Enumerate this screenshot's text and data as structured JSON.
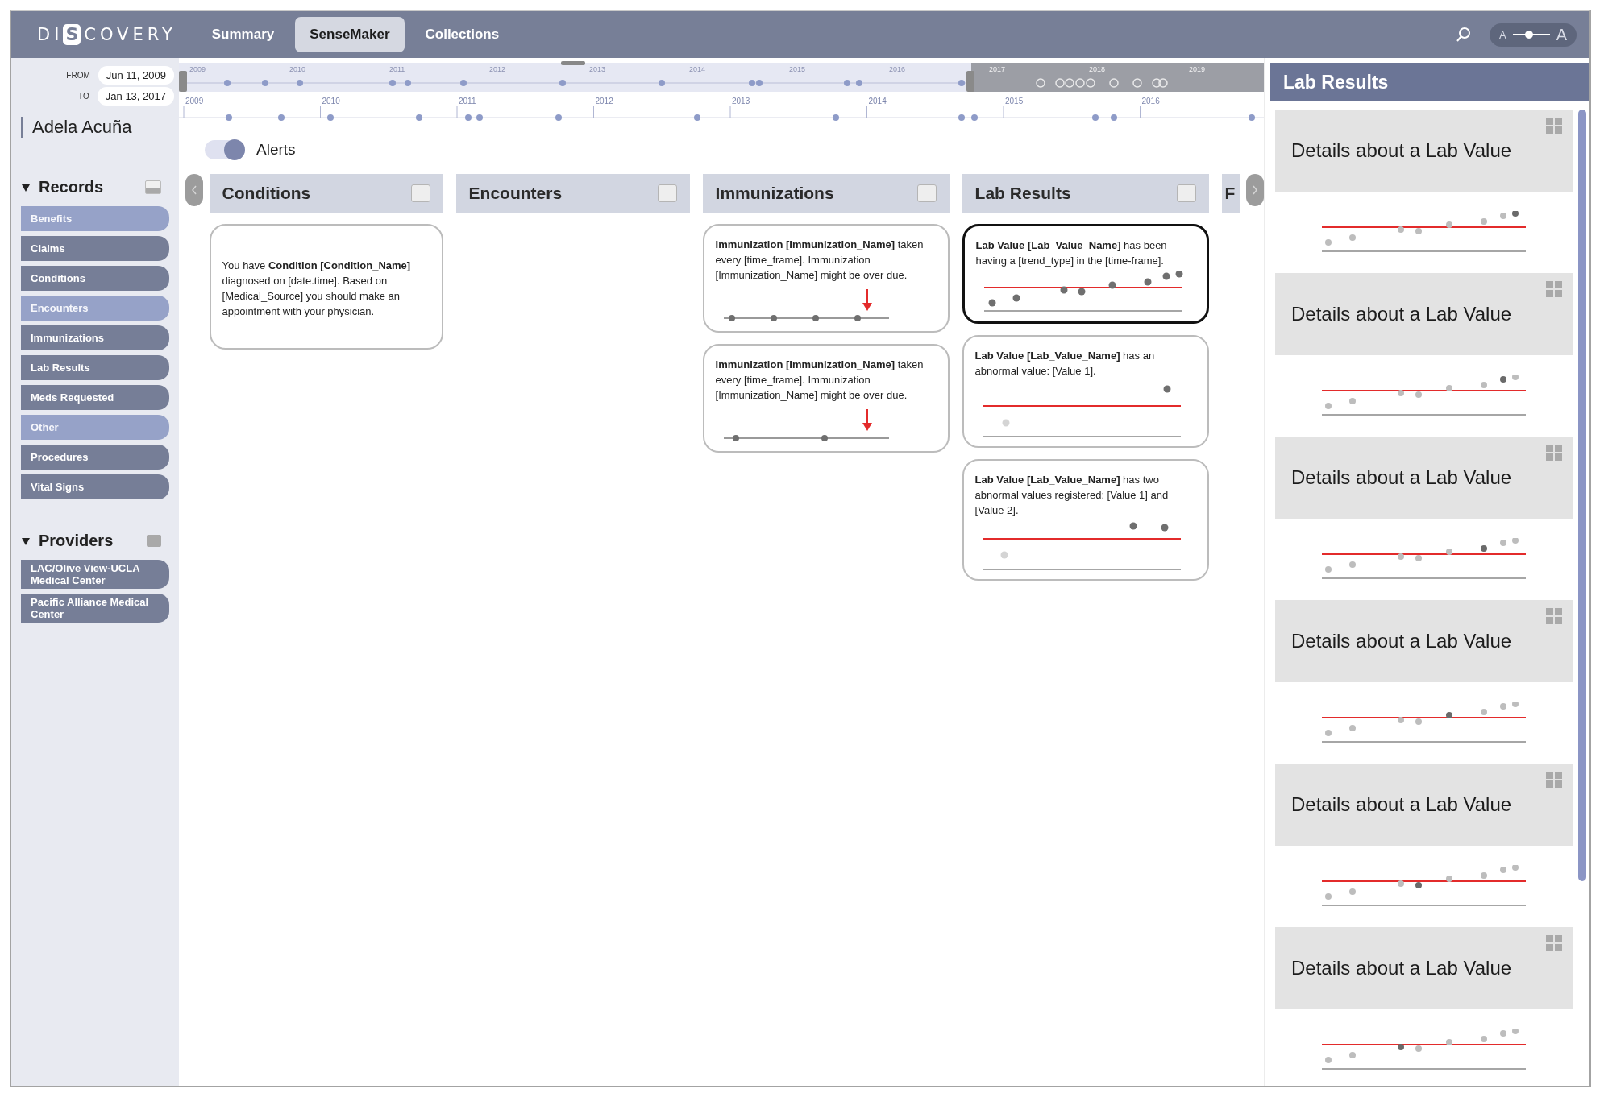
{
  "topbar": {
    "logo": {
      "before": "DI",
      "mark": "S",
      "after": "COVERY"
    },
    "nav": [
      {
        "label": "Summary",
        "selected": false
      },
      {
        "label": "SenseMaker",
        "selected": true
      },
      {
        "label": "Collections",
        "selected": false
      }
    ],
    "font_size_control": {
      "small": "A",
      "large": "A",
      "level": 0.45
    }
  },
  "date_range": {
    "from_label": "FROM",
    "from": "Jun 11, 2009",
    "to_label": "TO",
    "to": "Jan 13, 2017"
  },
  "timeline": {
    "overview_years": [
      "2009",
      "2010",
      "2011",
      "2012",
      "2013",
      "2014",
      "2015",
      "2016",
      "2017",
      "2018",
      "2019"
    ],
    "detail_years": [
      "2009",
      "2010",
      "2011",
      "2012",
      "2013",
      "2014",
      "2015",
      "2016"
    ]
  },
  "patient": {
    "name": "Adela Acuña"
  },
  "alerts_toggle": {
    "label": "Alerts",
    "on": true
  },
  "sidebar": {
    "sections": [
      {
        "title": "Records",
        "expanded": true,
        "items": [
          {
            "label": "Benefits",
            "disabled": true
          },
          {
            "label": "Claims",
            "disabled": false
          },
          {
            "label": "Conditions",
            "disabled": false
          },
          {
            "label": "Encounters",
            "disabled": true
          },
          {
            "label": "Immunizations",
            "disabled": false
          },
          {
            "label": "Lab Results",
            "disabled": false
          },
          {
            "label": "Meds Requested",
            "disabled": false
          },
          {
            "label": "Other",
            "disabled": true
          },
          {
            "label": "Procedures",
            "disabled": false
          },
          {
            "label": "Vital Signs",
            "disabled": false
          }
        ]
      },
      {
        "title": "Providers",
        "expanded": true,
        "items": [
          {
            "label": "LAC/Olive View-UCLA Medical Center",
            "disabled": false
          },
          {
            "label": "Pacific Alliance Medical Center",
            "disabled": false
          }
        ]
      }
    ]
  },
  "columns": [
    {
      "title": "Conditions",
      "checked": false,
      "cards": [
        {
          "kind": "text",
          "selected": false,
          "text": "You have **Condition [Condition_Name]** diagnosed on [date.time]. Based on [Medical_Source] you should make an appointment with your physician."
        }
      ]
    },
    {
      "title": "Encounters",
      "checked": false
    },
    {
      "title": "Immunizations",
      "checked": false,
      "cards": [
        {
          "kind": "doses-4",
          "selected": false,
          "text": "**Immunization [Immunization_Name]** taken every [time_frame]. Immunization [Immunization_Name] might be over due."
        },
        {
          "kind": "doses-2",
          "selected": false,
          "text": "**Immunization [Immunization_Name]** taken every [time_frame]. Immunization [Immunization_Name] might be over due."
        }
      ]
    },
    {
      "title": "Lab Results",
      "checked": false,
      "cards": [
        {
          "kind": "trend",
          "selected": true,
          "text": "**Lab Value [Lab_Value_Name]** has been having a [trend_type] in the [time-frame]."
        },
        {
          "kind": "abnormal-1",
          "selected": false,
          "text": "**Lab Value [Lab_Value_Name]** has an abnormal value: [Value 1]."
        },
        {
          "kind": "abnormal-2",
          "selected": false,
          "text": "**Lab Value [Lab_Value_Name]** has two abnormal values registered: [Value 1] and [Value 2]."
        }
      ]
    },
    {
      "title": "F"
    }
  ],
  "details_panel": {
    "title": "Lab Results",
    "items": [
      {
        "title": "Details about a Lab Value"
      },
      {
        "title": "Details about a Lab Value"
      },
      {
        "title": "Details about a Lab Value"
      },
      {
        "title": "Details about a Lab Value"
      },
      {
        "title": "Details about a Lab Value"
      },
      {
        "title": "Details about a Lab Value"
      }
    ]
  }
}
